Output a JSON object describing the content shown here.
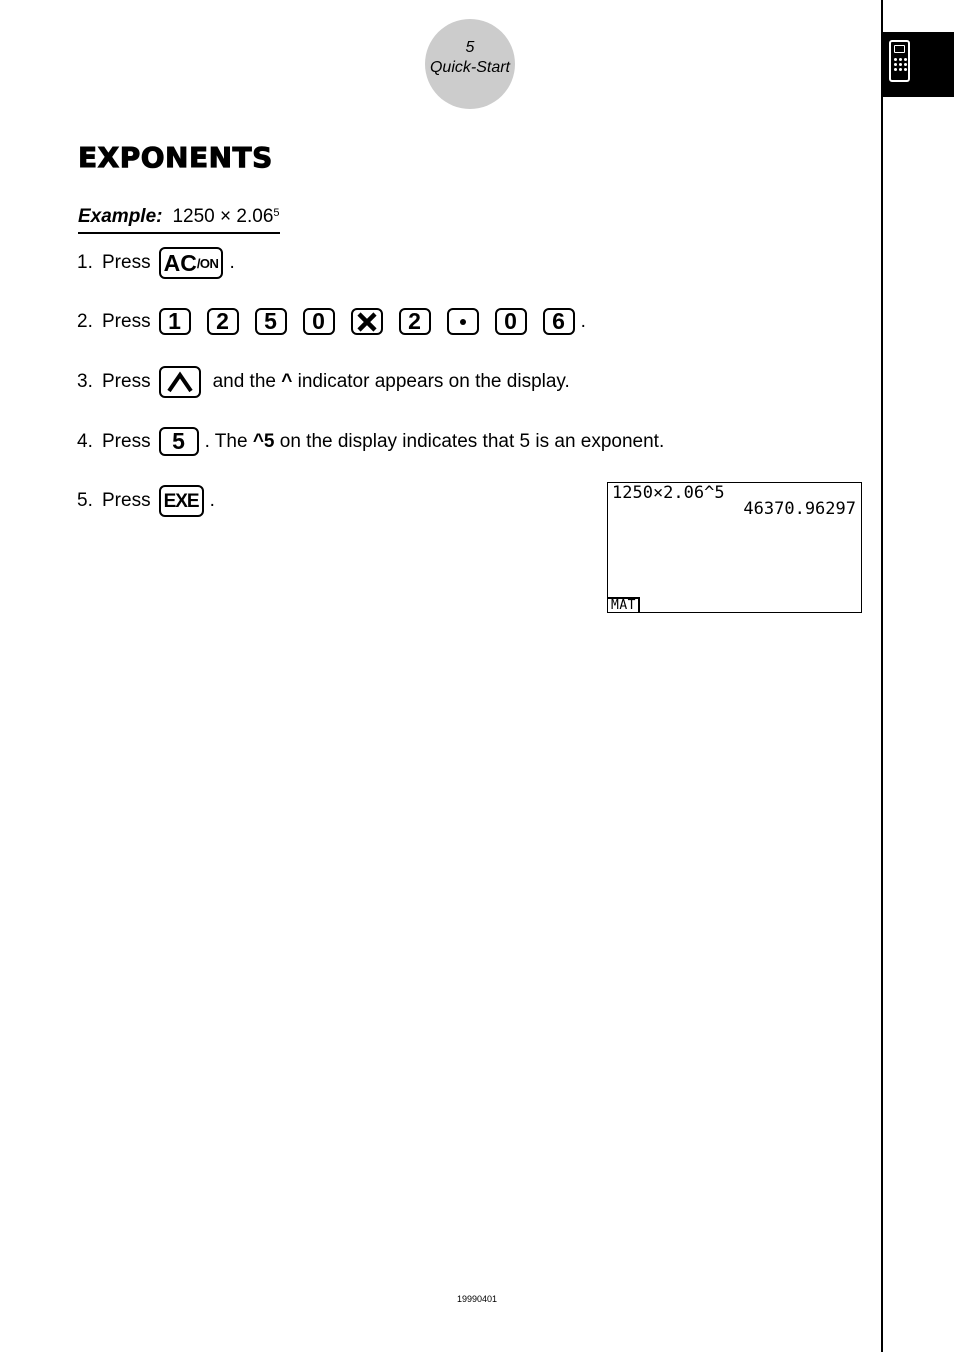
{
  "header": {
    "page_number": "5",
    "section": "Quick-Start",
    "side_tab_icon": "calculator-icon"
  },
  "title": "EXPONENTS",
  "example": {
    "label": "Example:",
    "expression": "1250 × 2.06",
    "exponent": "5"
  },
  "steps": [
    {
      "num": "1.",
      "press": "Press",
      "keys": [
        "AC/ON"
      ],
      "after": "."
    },
    {
      "num": "2.",
      "press": "Press",
      "keys": [
        "1",
        "2",
        "5",
        "0",
        "×",
        "2",
        "•",
        "0",
        "6"
      ],
      "after": "."
    },
    {
      "num": "3.",
      "press": "Press",
      "keys": [
        "^"
      ],
      "after_pre": "and the ",
      "after_bold": "^",
      "after_post": " indicator appears on the display."
    },
    {
      "num": "4.",
      "press": "Press",
      "keys": [
        "5"
      ],
      "after_pre": ". The ",
      "after_bold": "^5",
      "after_post": " on the display indicates that 5 is an exponent."
    },
    {
      "num": "5.",
      "press": "Press",
      "keys": [
        "EXE"
      ],
      "after": "."
    }
  ],
  "keys": {
    "ac": "AC",
    "on": "/ON",
    "exe": "EXE"
  },
  "display": {
    "line1": "1250×2.06^5",
    "line2": "46370.96297",
    "function_tab": "MAT"
  },
  "footer": "19990401"
}
